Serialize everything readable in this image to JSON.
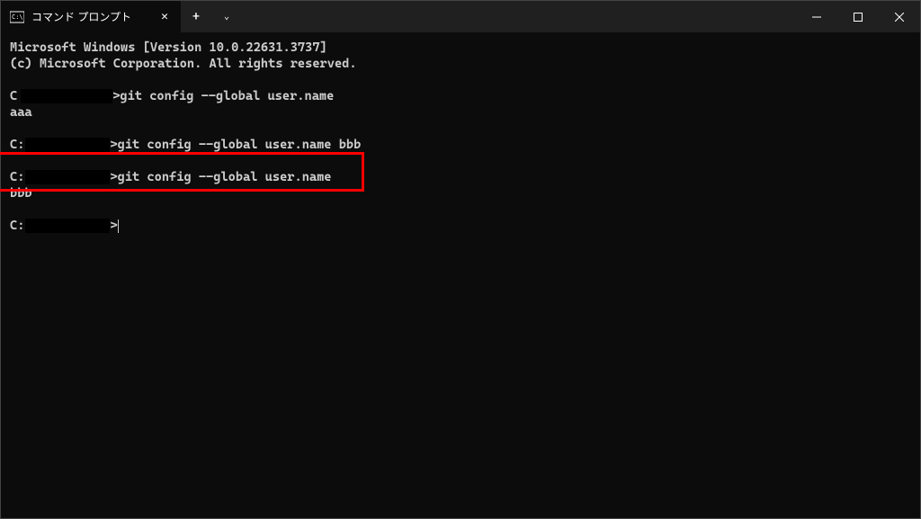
{
  "titlebar": {
    "tab_title": "コマンド プロンプト",
    "close_symbol": "✕",
    "new_tab_symbol": "+",
    "dropdown_symbol": "⌄"
  },
  "window_controls": {
    "minimize": "─",
    "maximize": "☐",
    "close": "✕"
  },
  "terminal": {
    "lines": [
      "Microsoft Windows [Version 10.0.22631.3737]",
      "(c) Microsoft Corporation. All rights reserved.",
      "",
      "",
      "aaa",
      "",
      "",
      "",
      "",
      "bbb",
      "",
      ""
    ],
    "prompt1_pre": "C",
    "prompt1_post": ">git config --global user.name",
    "prompt2_pre": "C:",
    "prompt2_post": ">git config --global user.name bbb",
    "prompt3_pre": "C:",
    "prompt3_post": ">git config --global user.name",
    "prompt4_pre": "C:",
    "prompt4_post": ">"
  }
}
